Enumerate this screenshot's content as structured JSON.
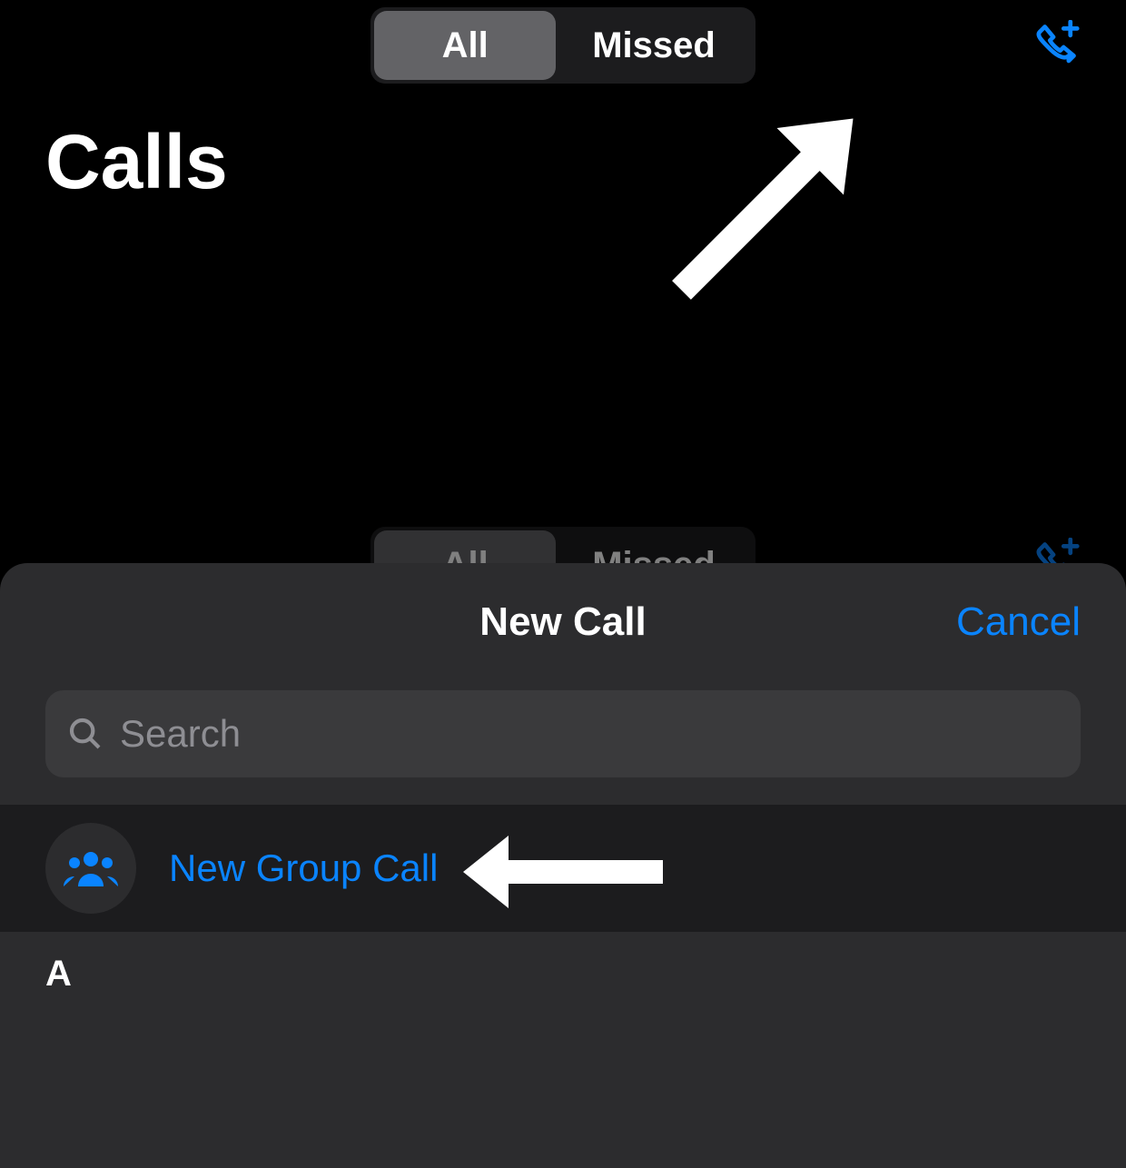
{
  "header": {
    "segmented": {
      "all_label": "All",
      "missed_label": "Missed"
    },
    "page_title": "Calls"
  },
  "sheet": {
    "title": "New Call",
    "cancel_label": "Cancel",
    "search_placeholder": "Search",
    "group_call_label": "New Group Call",
    "section_header": "A"
  },
  "colors": {
    "accent": "#0a84ff",
    "sheet_bg": "#2c2c2e",
    "row_bg": "#1c1c1e"
  }
}
